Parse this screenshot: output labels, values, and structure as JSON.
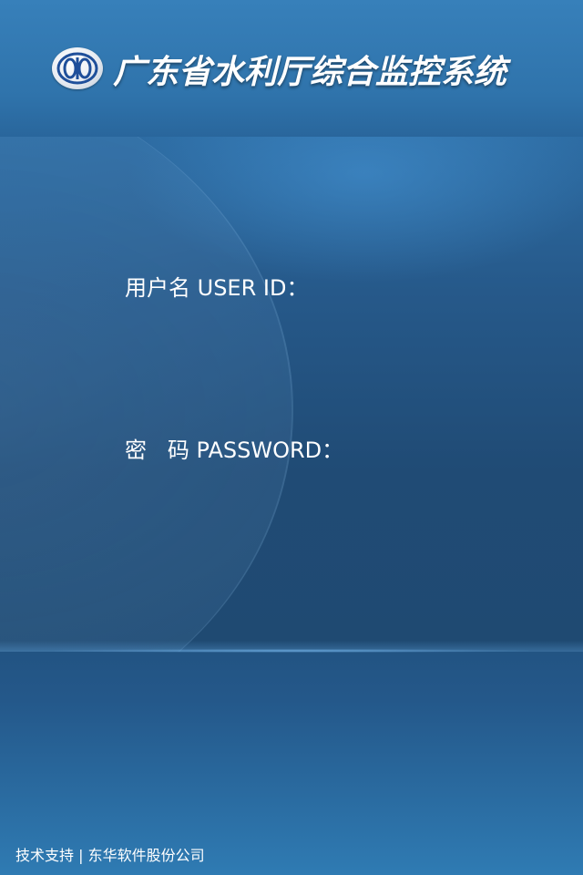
{
  "header": {
    "title": "广东省水利厅综合监控系统",
    "logo_icon": "water-resources-emblem-icon"
  },
  "login": {
    "username_label": "用户名 USER ID：",
    "username_value": "",
    "password_label": "密   码 PASSWORD：",
    "password_value": ""
  },
  "footer": {
    "support_text": "技术支持 | 东华软件股份公司"
  },
  "colors": {
    "background_top": "#3279b2",
    "background_mid": "#1f4d78",
    "text": "#ffffff",
    "logo_mark": "#1f4f9a"
  }
}
